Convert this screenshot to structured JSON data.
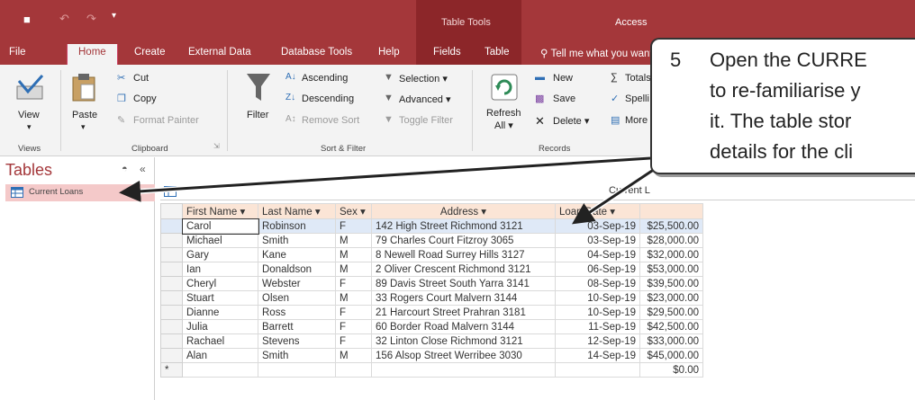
{
  "window": {
    "context_tab_group": "Table Tools",
    "app_title": "Access"
  },
  "tabs": [
    "File",
    "Home",
    "Create",
    "External Data",
    "Database Tools",
    "Help",
    "Fields",
    "Table"
  ],
  "tell_me": "Tell me what you want",
  "ribbon": {
    "views": {
      "view_label": "View",
      "group_label": "Views"
    },
    "clipboard": {
      "paste_label": "Paste",
      "cut_label": "Cut",
      "copy_label": "Copy",
      "format_painter_label": "Format Painter",
      "group_label": "Clipboard"
    },
    "sort_filter": {
      "filter_label": "Filter",
      "ascending_label": "Ascending",
      "descending_label": "Descending",
      "remove_sort_label": "Remove Sort",
      "selection_label": "Selection",
      "advanced_label": "Advanced",
      "toggle_filter_label": "Toggle Filter",
      "group_label": "Sort & Filter"
    },
    "records": {
      "refresh_label": "Refresh",
      "refresh_sub": "All",
      "new_label": "New",
      "save_label": "Save",
      "delete_label": "Delete",
      "totals_label": "Totals",
      "spelling_label": "Spelli",
      "more_label": "More",
      "group_label": "Records"
    }
  },
  "nav": {
    "title": "Tables",
    "items": [
      {
        "label": "Current Loans"
      }
    ]
  },
  "object_tab": {
    "label": "Current L"
  },
  "table": {
    "columns": [
      "First Name",
      "Last Name",
      "Sex",
      "Address",
      "Loan Date",
      ""
    ],
    "rows": [
      [
        "Carol",
        "Robinson",
        "F",
        "142 High Street Richmond 3121",
        "03-Sep-19",
        "$25,500.00"
      ],
      [
        "Michael",
        "Smith",
        "M",
        "79 Charles Court Fitzroy 3065",
        "03-Sep-19",
        "$28,000.00"
      ],
      [
        "Gary",
        "Kane",
        "M",
        "8 Newell Road Surrey Hills 3127",
        "04-Sep-19",
        "$32,000.00"
      ],
      [
        "Ian",
        "Donaldson",
        "M",
        "2 Oliver Crescent Richmond 3121",
        "06-Sep-19",
        "$53,000.00"
      ],
      [
        "Cheryl",
        "Webster",
        "F",
        "89 Davis Street South Yarra 3141",
        "08-Sep-19",
        "$39,500.00"
      ],
      [
        "Stuart",
        "Olsen",
        "M",
        "33 Rogers Court Malvern 3144",
        "10-Sep-19",
        "$23,000.00"
      ],
      [
        "Dianne",
        "Ross",
        "F",
        "21 Harcourt Street Prahran 3181",
        "10-Sep-19",
        "$29,500.00"
      ],
      [
        "Julia",
        "Barrett",
        "F",
        "60 Border Road Malvern 3144",
        "11-Sep-19",
        "$42,500.00"
      ],
      [
        "Rachael",
        "Stevens",
        "F",
        "32 Linton Close Richmond 3121",
        "12-Sep-19",
        "$33,000.00"
      ],
      [
        "Alan",
        "Smith",
        "M",
        "156 Alsop Street Werribee 3030",
        "14-Sep-19",
        "$45,000.00"
      ]
    ],
    "new_row_marker": "*",
    "new_row_amount": "$0.00"
  },
  "callout": {
    "number": "5",
    "lines": [
      "Open the CURRE",
      "to re-familiarise y",
      "it. The table stor",
      "details for the cli"
    ]
  },
  "colors": {
    "accent": "#a4373a",
    "header_fill": "#fbe5d6",
    "selected_row": "#dfe9f7"
  }
}
